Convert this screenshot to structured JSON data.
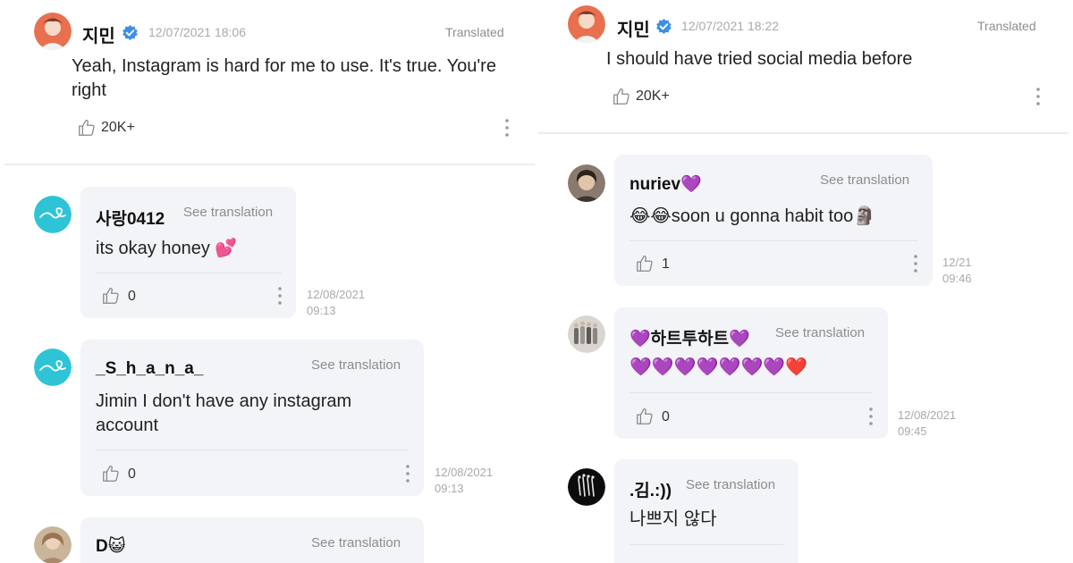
{
  "left": {
    "post": {
      "author": "지민",
      "time": "12/07/2021 18:06",
      "translated_label": "Translated",
      "text": "Yeah, Instagram is hard for me to use. It's true. You're right",
      "likes": "20K+"
    },
    "comments": [
      {
        "author": "사랑0412",
        "see_translation": "See translation",
        "text": "its okay honey 💕",
        "likes": "0",
        "date": "12/08/2021",
        "time": "09:13"
      },
      {
        "author": "_S_h_a_n_a_",
        "see_translation": "See translation",
        "text": "Jimin I don't have any instagram account",
        "likes": "0",
        "date": "12/08/2021",
        "time": "09:13"
      },
      {
        "author": "D😺",
        "see_translation": "See translation"
      }
    ]
  },
  "right": {
    "post": {
      "author": "지민",
      "time": "12/07/2021 18:22",
      "translated_label": "Translated",
      "text": "I should have tried social media before",
      "likes": "20K+"
    },
    "comments": [
      {
        "author": "nuriev💜",
        "see_translation": "See translation",
        "text": "😂😂soon u gonna habit too🗿",
        "likes": "1",
        "date": "12/21",
        "time": "09:46"
      },
      {
        "author": "💜하트투하트💜",
        "see_translation": "See translation",
        "text": "💜💜💜💜💜💜💜❤️",
        "likes": "0",
        "date": "12/08/2021",
        "time": "09:45"
      },
      {
        "author": ".김.:))",
        "see_translation": "See translation",
        "text": "나쁘지 않다"
      }
    ]
  },
  "colors": {
    "verified": "#3d8fe6",
    "accent_teal": "#2ec4d6",
    "bubble": "#f3f4f8"
  },
  "icons": [
    "verified-icon",
    "thumbs-up-icon",
    "more-vertical-icon",
    "avatar-icon"
  ]
}
